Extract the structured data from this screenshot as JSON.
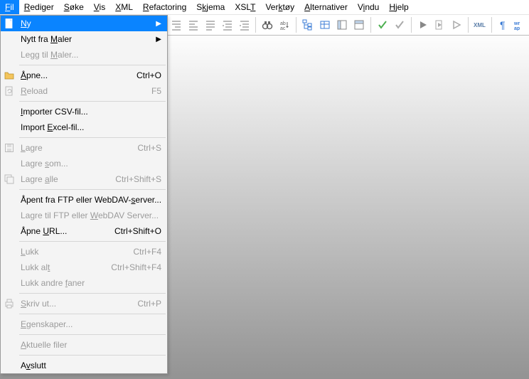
{
  "menubar": {
    "file": {
      "pre": "",
      "m": "F",
      "post": "il"
    },
    "edit": {
      "pre": "",
      "m": "R",
      "post": "ediger"
    },
    "search": {
      "pre": "",
      "m": "S",
      "post": "øke"
    },
    "view": {
      "pre": "",
      "m": "V",
      "post": "is"
    },
    "xml": {
      "pre": "",
      "m": "X",
      "post": "ML"
    },
    "refactor": {
      "pre": "",
      "m": "R",
      "post": "efactoring"
    },
    "schema": {
      "pre": "S",
      "m": "k",
      "post": "jema"
    },
    "xslt": {
      "pre": "XSL",
      "m": "T",
      "post": ""
    },
    "tools": {
      "pre": "Ver",
      "m": "k",
      "post": "tøy"
    },
    "options": {
      "pre": "",
      "m": "A",
      "post": "lternativer"
    },
    "window": {
      "pre": "V",
      "m": "i",
      "post": "ndu"
    },
    "help": {
      "pre": "",
      "m": "H",
      "post": "jelp"
    }
  },
  "menu": {
    "new": {
      "pre": "",
      "m": "N",
      "post": "y"
    },
    "newFromTmpl": {
      "pre": "Nytt fra ",
      "m": "M",
      "post": "aler"
    },
    "addTmpl": {
      "pre": "Legg til ",
      "m": "M",
      "post": "aler..."
    },
    "open": {
      "pre": "",
      "m": "Å",
      "post": "pne...",
      "sc": "Ctrl+O"
    },
    "reload": {
      "pre": "",
      "m": "R",
      "post": "eload",
      "sc": "F5"
    },
    "importCsv": {
      "pre": "",
      "m": "I",
      "post": "mporter CSV-fil..."
    },
    "importXls": {
      "pre": "Import ",
      "m": "E",
      "post": "xcel-fil..."
    },
    "save": {
      "pre": "",
      "m": "L",
      "post": "agre",
      "sc": "Ctrl+S"
    },
    "saveAs": {
      "pre": "Lagre ",
      "m": "s",
      "post": "om..."
    },
    "saveAll": {
      "pre": "Lagre ",
      "m": "a",
      "post": "lle",
      "sc": "Ctrl+Shift+S"
    },
    "openFtp": {
      "pre": "Åpent fra FTP eller WebDAV-",
      "m": "s",
      "post": "erver..."
    },
    "saveFtp": {
      "pre": "Lagre til FTP eller ",
      "m": "W",
      "post": "ebDAV Server..."
    },
    "openUrl": {
      "pre": "Åpne ",
      "m": "U",
      "post": "RL...",
      "sc": "Ctrl+Shift+O"
    },
    "close": {
      "pre": "",
      "m": "L",
      "post": "ukk",
      "sc": "Ctrl+F4"
    },
    "closeAll": {
      "pre": "Lukk al",
      "m": "t",
      "post": "",
      "sc": "Ctrl+Shift+F4"
    },
    "closeOther": {
      "pre": "Lukk andre ",
      "m": "f",
      "post": "aner"
    },
    "print": {
      "pre": "",
      "m": "S",
      "post": "kriv ut...",
      "sc": "Ctrl+P"
    },
    "props": {
      "pre": "",
      "m": "E",
      "post": "genskaper..."
    },
    "recent": {
      "pre": "",
      "m": "A",
      "post": "ktuelle filer"
    },
    "exit": {
      "pre": "A",
      "m": "v",
      "post": "slutt"
    }
  }
}
